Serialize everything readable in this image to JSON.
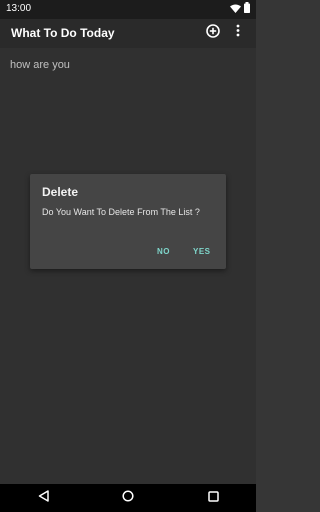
{
  "status_bar": {
    "time": "13:00",
    "icons": [
      "wifi-icon",
      "battery-icon"
    ]
  },
  "app_bar": {
    "title": "What To Do Today",
    "actions": [
      "add-circle-icon",
      "more-vert-icon"
    ]
  },
  "list": {
    "items": [
      {
        "text": "how are you"
      }
    ]
  },
  "dialog": {
    "title": "Delete",
    "message": "Do You Want To Delete From The List ?",
    "negative_label": "NO",
    "positive_label": "YES"
  },
  "nav_bar": {
    "icons": [
      "back-icon",
      "home-icon",
      "recents-icon"
    ]
  },
  "colors": {
    "background": "#363636",
    "app_bar": "#2a2a2a",
    "dialog": "#454545",
    "accent": "#7fd6cb"
  }
}
